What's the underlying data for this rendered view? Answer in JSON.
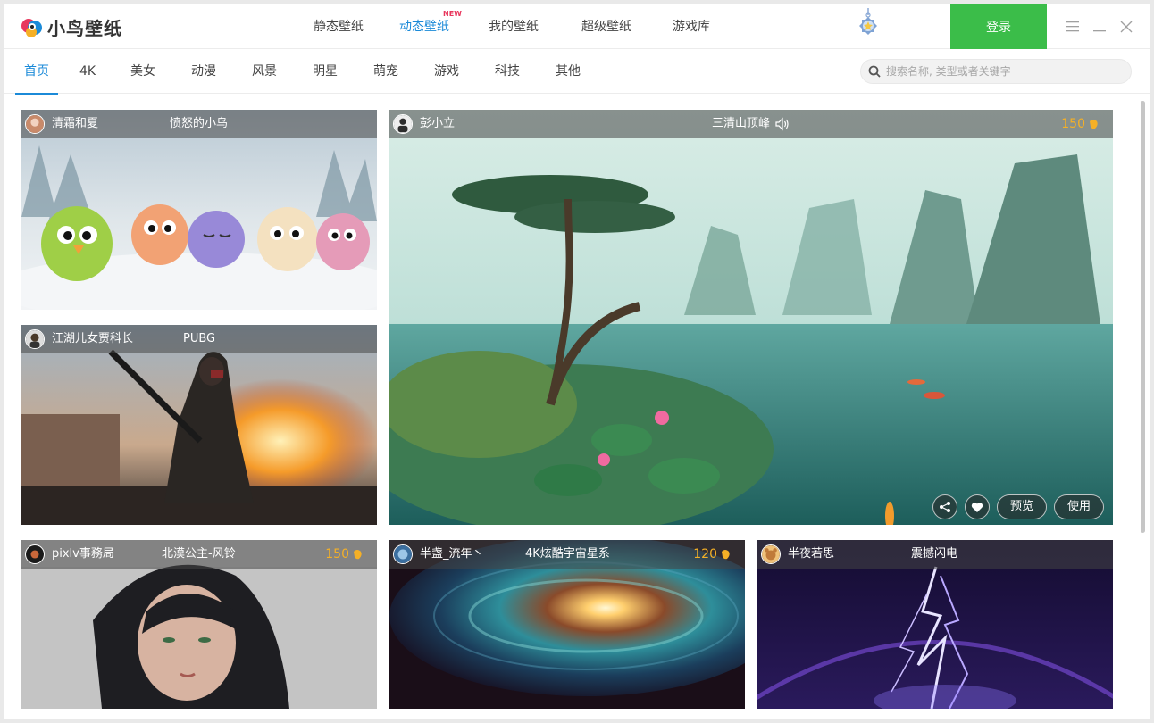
{
  "app": {
    "name": "小鸟壁纸"
  },
  "topnav": [
    {
      "label": "静态壁纸"
    },
    {
      "label": "动态壁纸",
      "badge": "NEW"
    },
    {
      "label": "我的壁纸"
    },
    {
      "label": "超级壁纸"
    },
    {
      "label": "游戏库"
    }
  ],
  "login_label": "登录",
  "categories": [
    "首页",
    "4K",
    "美女",
    "动漫",
    "风景",
    "明星",
    "萌宠",
    "游戏",
    "科技",
    "其他"
  ],
  "search": {
    "placeholder": "搜索名称, 类型或者关键字"
  },
  "cards": [
    {
      "author": "清霜和夏",
      "title": "愤怒的小鸟"
    },
    {
      "author": "彭小立",
      "title": "三清山顶峰",
      "price": "150",
      "actions": {
        "preview": "预览",
        "use": "使用"
      }
    },
    {
      "author": "江湖儿女贾科长",
      "title": "PUBG"
    },
    {
      "author": "pixlv事務局",
      "title": "北漠公主-风铃",
      "price": "150"
    },
    {
      "author": "半盏_流年丶",
      "title": "4K炫酷宇宙星系",
      "price": "120"
    },
    {
      "author": "半夜若思",
      "title": "震撼闪电"
    }
  ],
  "colors": {
    "accent": "#1b8ad8",
    "login": "#3bbd49",
    "price": "#f5b026",
    "new_badge": "#e8375d"
  }
}
